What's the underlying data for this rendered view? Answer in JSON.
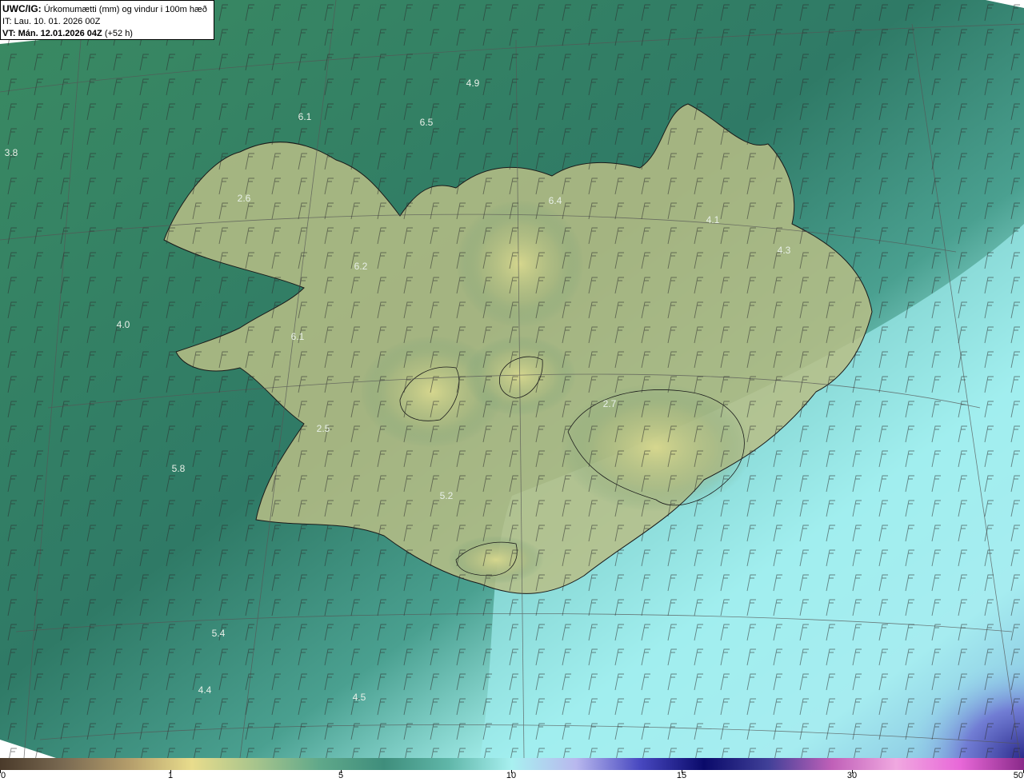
{
  "header": {
    "title_prefix": "UWC/IG:",
    "title": "Úrkomumætti (mm) og vindur i 100m hæð",
    "it_line": "IT: Lau. 10. 01. 2026 00Z",
    "vt_prefix": "VT:",
    "vt_date": "Mán. 12.01.2026 04Z",
    "vt_lead": "(+52 h)"
  },
  "map_labels": [
    {
      "id": "label-4-9",
      "text": "4.9"
    },
    {
      "id": "label-6-1-north",
      "text": "6.1"
    },
    {
      "id": "label-6-5",
      "text": "6.5"
    },
    {
      "id": "label-3-8",
      "text": "3.8"
    },
    {
      "id": "label-2-6",
      "text": "2.6"
    },
    {
      "id": "label-6-4",
      "text": "6.4"
    },
    {
      "id": "label-4-1",
      "text": "4.1"
    },
    {
      "id": "label-4-3",
      "text": "4.3"
    },
    {
      "id": "label-6-2",
      "text": "6.2"
    },
    {
      "id": "label-4-0",
      "text": "4.0"
    },
    {
      "id": "label-6-1-west",
      "text": "6.1"
    },
    {
      "id": "label-2-7",
      "text": "2.7"
    },
    {
      "id": "label-2-5",
      "text": "2.5"
    },
    {
      "id": "label-5-8",
      "text": "5.8"
    },
    {
      "id": "label-5-2",
      "text": "5.2"
    },
    {
      "id": "label-5-4",
      "text": "5.4"
    },
    {
      "id": "label-4-4",
      "text": "4.4"
    },
    {
      "id": "label-4-5",
      "text": "4.5"
    }
  ],
  "colorbar": {
    "labels": [
      "0",
      "1",
      "5",
      "10",
      "15",
      "30",
      "50"
    ],
    "stops": [
      "#4a3a2a",
      "#7a6a52",
      "#b39c6a",
      "#e8dc8c",
      "#a6c48c",
      "#5fa88a",
      "#3f8e7c",
      "#5fb6a8",
      "#a8f0f0",
      "#b8b8ee",
      "#4848c0",
      "#0a0a6a",
      "#404098",
      "#c060b8",
      "#f0a8e0",
      "#e868d8",
      "#8a2a8a"
    ]
  },
  "colors": {
    "sea_dark": "#2f7a64",
    "sea_light": "#a8f4f4",
    "land": "#c8c88a",
    "coastline": "#1a1a1a"
  }
}
